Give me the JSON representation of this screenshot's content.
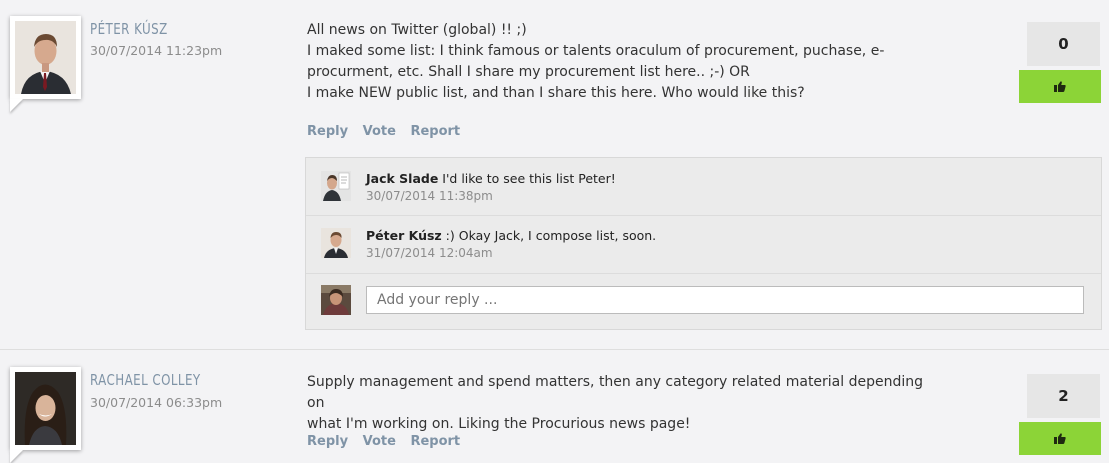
{
  "posts": [
    {
      "author": "PÉTER KÚSZ",
      "date": "30/07/2014 11:23pm",
      "lines": [
        "All news on Twitter (global) !! ;)",
        "I maked some list: I think famous or talents oraculum of procurement, puchase, e-",
        "procurment, etc. Shall I share my procurement list here.. ;-) OR",
        "I make NEW public list, and than I share this here. Who would like this?"
      ],
      "actions": {
        "reply": "Reply",
        "vote": "Vote",
        "report": "Report"
      },
      "vote_count": "0",
      "replies": [
        {
          "name": "Jack Slade",
          "text": " I'd like to see this list Peter!",
          "date": "30/07/2014 11:38pm"
        },
        {
          "name": "Péter Kúsz",
          "text": " :) Okay Jack, I compose list, soon.",
          "date": "31/07/2014 12:04am"
        }
      ],
      "reply_placeholder": "Add your reply ..."
    },
    {
      "author": "RACHAEL COLLEY",
      "date": "30/07/2014 06:33pm",
      "lines": [
        "Supply management and spend matters, then any category related material depending on",
        "what I'm working on. Liking the Procurious news page!"
      ],
      "actions": {
        "reply": "Reply",
        "vote": "Vote",
        "report": "Report"
      },
      "vote_count": "2"
    }
  ],
  "icons": {
    "vote": "thumbs-up-icon"
  },
  "colors": {
    "accent_green": "#8cd437",
    "link_blue": "#7f93a6"
  }
}
